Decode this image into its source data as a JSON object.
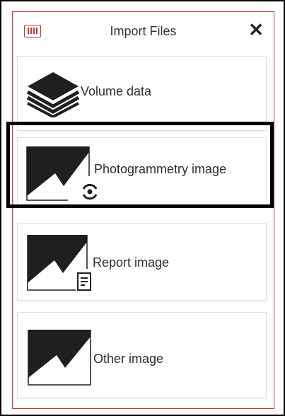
{
  "dialog": {
    "title": "Import Files",
    "close_symbol": "✕",
    "app_icon": "instance-logo-icon"
  },
  "items": [
    {
      "label": "Volume data",
      "icon": "layers-stack-icon"
    },
    {
      "label": "Photogrammetry image",
      "icon": "photogrammetry-image-icon",
      "selected": true
    },
    {
      "label": "Report image",
      "icon": "report-image-icon"
    },
    {
      "label": "Other image",
      "icon": "image-icon"
    }
  ],
  "colors": {
    "accent": "#c9353a",
    "icon_dark": "#1f1f1f",
    "selection_border": "#000000"
  }
}
